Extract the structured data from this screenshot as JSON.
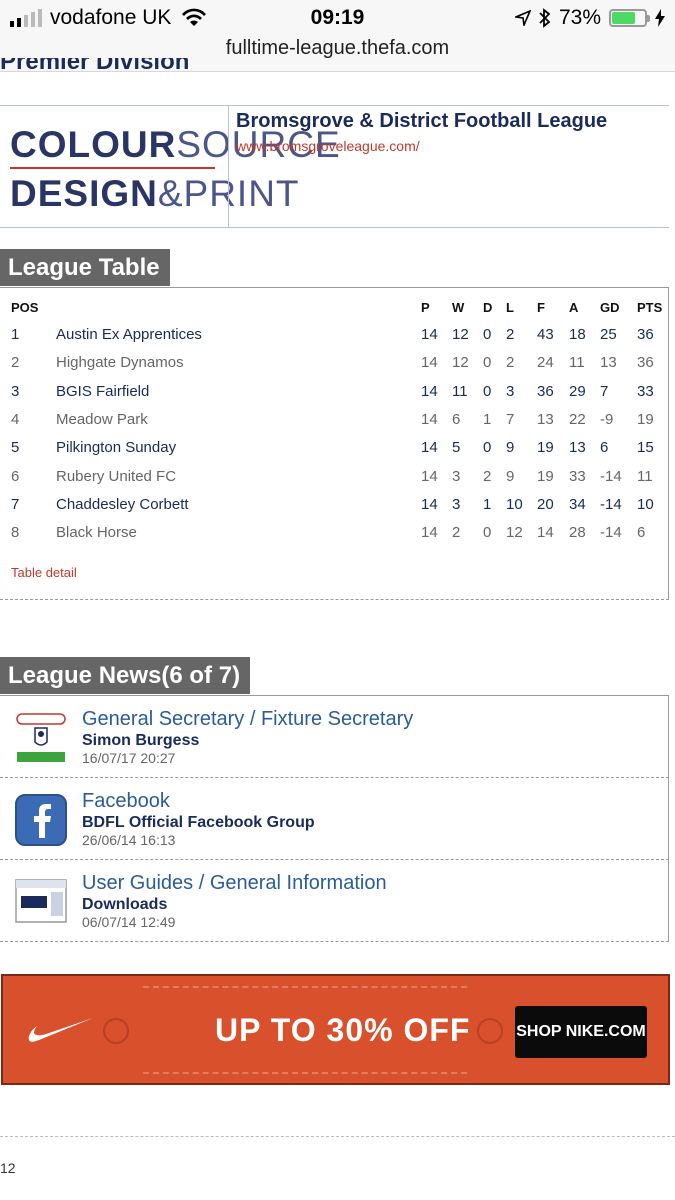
{
  "status_bar": {
    "carrier": "vodafone UK",
    "time": "09:19",
    "battery": "73%",
    "battery_level": 0.73
  },
  "browser": {
    "url": "fulltime-league.thefa.com"
  },
  "page": {
    "cut_heading": "Premier Division"
  },
  "banner": {
    "logo_line1_bold": "COLOUR",
    "logo_line1_thin": "SOURCE",
    "logo_line2_bold": "DESIGN",
    "logo_line2_thin": "&PRINT",
    "league_name": "Bromsgrove & District Football League",
    "league_url": "www.bromsgroveleague.com/"
  },
  "league_table": {
    "heading": "League Table",
    "columns": [
      "POS",
      "P",
      "W",
      "D",
      "L",
      "F",
      "A",
      "GD",
      "PTS"
    ],
    "rows": [
      [
        "1",
        "Austin Ex Apprentices",
        "14",
        "12",
        "0",
        "2",
        "43",
        "18",
        "25",
        "36"
      ],
      [
        "2",
        "Highgate Dynamos",
        "14",
        "12",
        "0",
        "2",
        "24",
        "11",
        "13",
        "36"
      ],
      [
        "3",
        "BGIS Fairfield",
        "14",
        "11",
        "0",
        "3",
        "36",
        "29",
        "7",
        "33"
      ],
      [
        "4",
        "Meadow Park",
        "14",
        "6",
        "1",
        "7",
        "13",
        "22",
        "-9",
        "19"
      ],
      [
        "5",
        "Pilkington Sunday",
        "14",
        "5",
        "0",
        "9",
        "19",
        "13",
        "6",
        "15"
      ],
      [
        "6",
        "Rubery United FC",
        "14",
        "3",
        "2",
        "9",
        "19",
        "33",
        "-14",
        "11"
      ],
      [
        "7",
        "Chaddesley Corbett",
        "14",
        "3",
        "1",
        "10",
        "20",
        "34",
        "-14",
        "10"
      ],
      [
        "8",
        "Black Horse",
        "14",
        "2",
        "0",
        "12",
        "14",
        "28",
        "-14",
        "6"
      ]
    ],
    "detail_link": "Table detail"
  },
  "league_news": {
    "heading": "League News(6 of 7)",
    "items": [
      {
        "icon": "league-crest-icon",
        "title": "General Secretary / Fixture Secretary",
        "subtitle": "Simon Burgess",
        "date": "16/07/17 20:27"
      },
      {
        "icon": "facebook-icon",
        "title": "Facebook",
        "subtitle": "BDFL Official Facebook Group",
        "date": "26/06/14 16:13"
      },
      {
        "icon": "fulltime-guide-icon",
        "title": "User Guides / General Information",
        "subtitle": "Downloads",
        "date": "06/07/14 12:49"
      }
    ]
  },
  "ad": {
    "headline": "UP TO 30% OFF",
    "button": "SHOP NIKE.COM",
    "brand_icon": "nike-swoosh-icon"
  },
  "footer": {
    "page_number": "12"
  },
  "colors": {
    "navy": "#1a2a5a",
    "link_red": "#c0392b",
    "tab_grey": "#666666",
    "news_blue": "#2a5c9a",
    "ad_orange": "#d9502c"
  }
}
